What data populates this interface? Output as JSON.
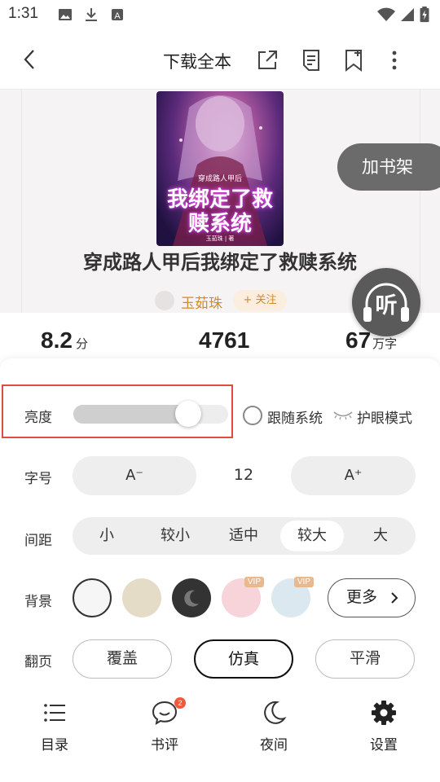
{
  "status_bar": {
    "time": "1:31"
  },
  "nav": {
    "download_label": "下载全本"
  },
  "book": {
    "cover_subtitle": "穿成路人甲后",
    "cover_title": "我绑定了救赎系统",
    "cover_author": "玉茹珠 | 著",
    "title": "穿成路人甲后我绑定了救赎系统",
    "author": "玉茹珠",
    "follow_label": "+ 关注"
  },
  "stats": [
    {
      "value": "8.2",
      "unit": "分"
    },
    {
      "value": "4761",
      "unit": ""
    },
    {
      "value": "67",
      "unit": "万字"
    }
  ],
  "shelf_label": "加书架",
  "listen_label": "听",
  "settings": {
    "brightness": {
      "label": "亮度",
      "level": 0.74,
      "follow_system_label": "跟随系统",
      "eye_mode_label": "护眼模式"
    },
    "font_size": {
      "label": "字号",
      "decrease_label": "A⁻",
      "value": "12",
      "increase_label": "A⁺"
    },
    "spacing": {
      "label": "间距",
      "options": [
        "小",
        "较小",
        "适中",
        "较大",
        "大"
      ],
      "selected": "较大"
    },
    "background": {
      "label": "背景",
      "swatches": [
        {
          "name": "white",
          "color": "#f6f6f6"
        },
        {
          "name": "beige",
          "color": "#e5dcc7"
        },
        {
          "name": "night",
          "color": "#333333"
        },
        {
          "name": "pink",
          "color": "#f7d3da",
          "vip": "VIP"
        },
        {
          "name": "blue",
          "color": "#dbe8f0",
          "vip": "VIP"
        }
      ],
      "more_label": "更多"
    },
    "page_turn": {
      "label": "翻页",
      "options": [
        "覆盖",
        "仿真",
        "平滑"
      ],
      "selected": "仿真"
    }
  },
  "tab_bar": [
    {
      "label": "目录",
      "icon": "list-icon"
    },
    {
      "label": "书评",
      "icon": "comment-icon",
      "badge": "2"
    },
    {
      "label": "夜间",
      "icon": "moon-icon"
    },
    {
      "label": "设置",
      "icon": "gear-icon"
    }
  ]
}
